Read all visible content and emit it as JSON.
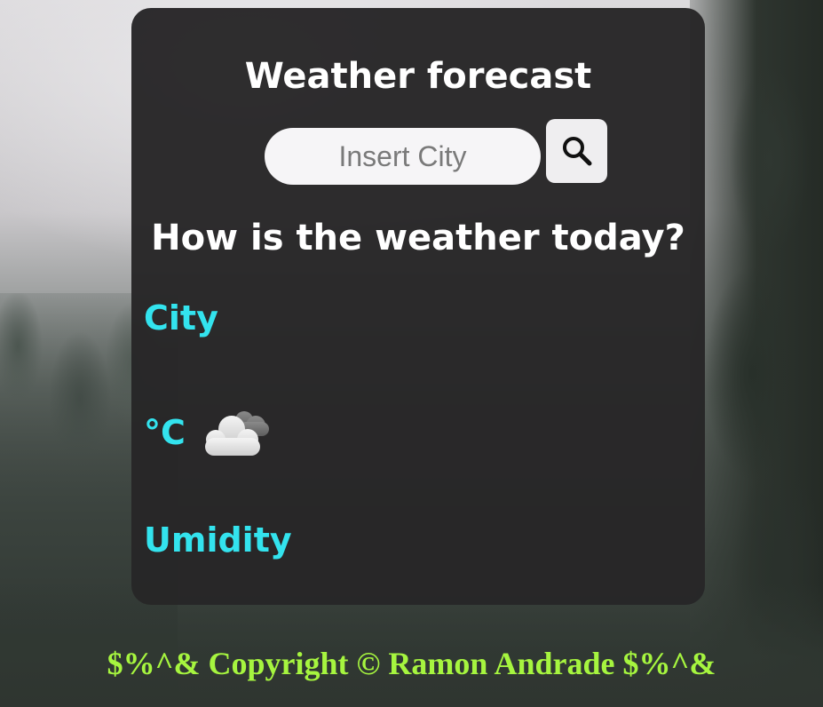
{
  "app": {
    "title": "Weather forecast"
  },
  "search": {
    "placeholder": "Insert City",
    "value": "",
    "button_icon": "search-icon"
  },
  "main": {
    "question": "How is the weather today?",
    "city_label": "City",
    "temperature_unit": "°C",
    "weather_icon": "cloud-icon",
    "humidity_label": "Umidity"
  },
  "footer": {
    "text": "$%^& Copyright © Ramon Andrade $%^&"
  },
  "colors": {
    "card_background": "#272627",
    "title_text": "#ffffff",
    "info_accent": "#33e3ee",
    "footer_text": "#a6f53f"
  }
}
